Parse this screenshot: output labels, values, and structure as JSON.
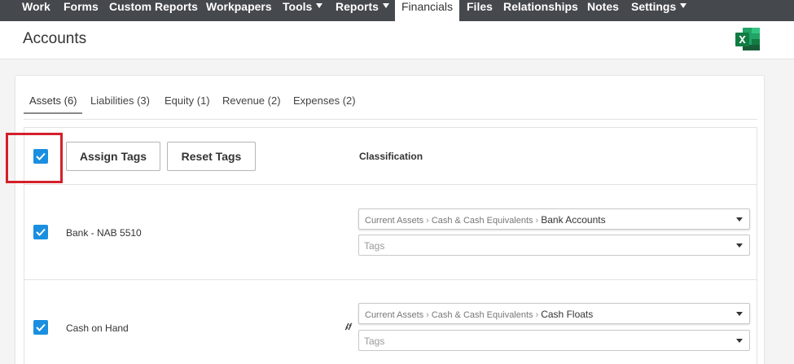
{
  "nav": {
    "items": [
      {
        "label": "Work"
      },
      {
        "label": "Forms"
      },
      {
        "label": "Custom Reports"
      },
      {
        "label": "Workpapers"
      },
      {
        "label": "Tools",
        "dropdown": true
      },
      {
        "label": "Reports",
        "dropdown": true
      },
      {
        "label": "Financials",
        "active": true
      },
      {
        "label": "Files"
      },
      {
        "label": "Relationships"
      },
      {
        "label": "Notes"
      },
      {
        "label": "Settings",
        "dropdown": true
      }
    ]
  },
  "header": {
    "title": "Accounts",
    "export_icon": "excel-icon"
  },
  "tabs": [
    {
      "label": "Assets (6)",
      "active": true
    },
    {
      "label": "Liabilities (3)"
    },
    {
      "label": "Equity (1)"
    },
    {
      "label": "Revenue (2)"
    },
    {
      "label": "Expenses (2)"
    }
  ],
  "toolbar": {
    "select_all_checked": true,
    "assign_tags_label": "Assign Tags",
    "reset_tags_label": "Reset Tags",
    "classification_header": "Classification"
  },
  "accounts": [
    {
      "name": "Bank - NAB 5510",
      "checked": true,
      "classification_path": [
        "Current Assets",
        "Cash & Cash Equivalents"
      ],
      "classification_leaf": "Bank Accounts",
      "tags_placeholder": "Tags"
    },
    {
      "name": "Cash on Hand",
      "checked": true,
      "classification_path": [
        "Current Assets",
        "Cash & Cash Equivalents"
      ],
      "classification_leaf": "Cash Floats",
      "tags_placeholder": "Tags",
      "linked_icon": "unlink-icon"
    }
  ],
  "colors": {
    "nav_bg": "#45484d",
    "checkbox": "#1a8fe0",
    "highlight": "#d4202a",
    "excel_green": "#1d7044"
  }
}
